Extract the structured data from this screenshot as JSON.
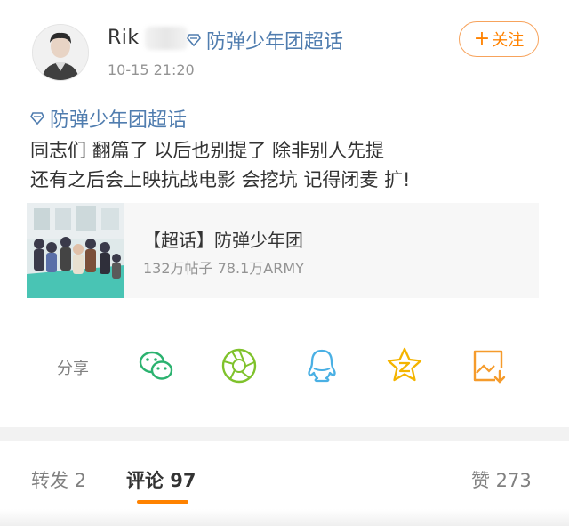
{
  "post": {
    "username_visible": "Rik",
    "topic": "防弹少年团超话",
    "timestamp": "10-15 21:20",
    "follow_label": "关注",
    "follow_plus": "+",
    "body_topic": "防弹少年团超话",
    "body_lines": [
      "同志们 翻篇了 以后也别提了 除非别人先提",
      "还有之后会上映抗战电影 会挖坑 记得闭麦 扩!"
    ]
  },
  "card": {
    "title": "【超话】防弹少年团",
    "stats": "132万帖子 78.1万ARMY"
  },
  "share": {
    "label": "分享",
    "targets": [
      {
        "icon": "wechat-icon"
      },
      {
        "icon": "moments-icon"
      },
      {
        "icon": "qq-icon"
      },
      {
        "icon": "qzone-icon"
      },
      {
        "icon": "save-image-icon"
      }
    ]
  },
  "tabs": {
    "repost": "转发 2",
    "comment": "评论 97",
    "like": "赞 273"
  },
  "colors": {
    "accent": "#ff8200",
    "link": "#507daf",
    "wechat": "#2bb26f",
    "moments": "#7fc22c",
    "qq": "#4ab0e4",
    "qzone": "#f4b400",
    "save": "#f59b2b"
  }
}
